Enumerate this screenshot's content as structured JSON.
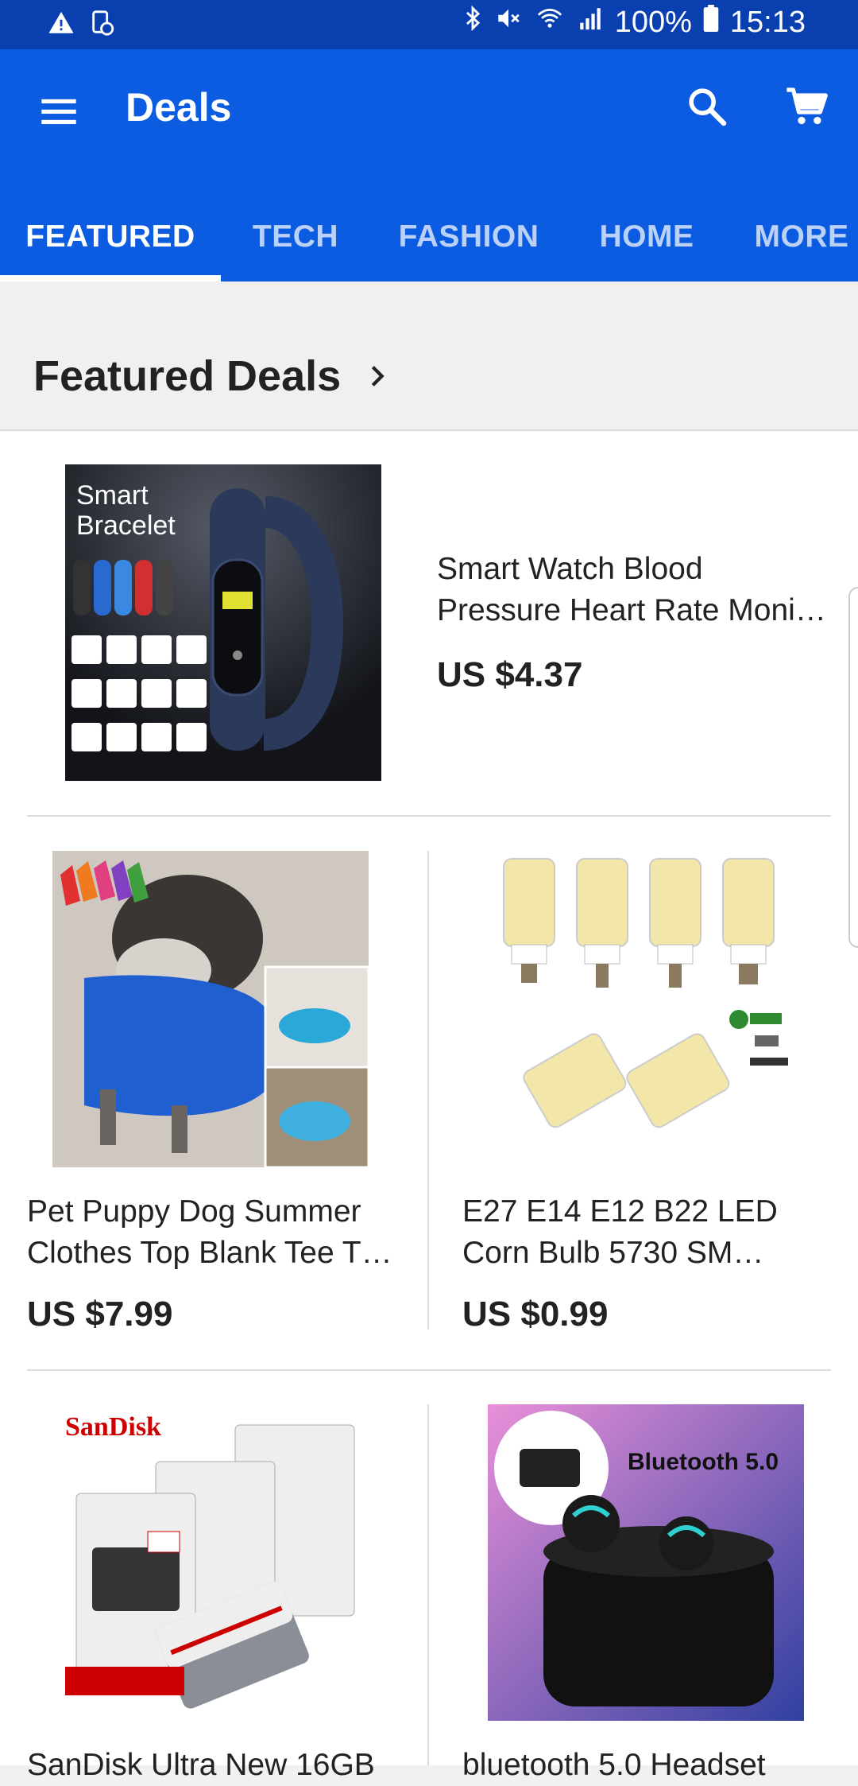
{
  "status": {
    "battery": "100%",
    "time": "15:13"
  },
  "appbar": {
    "title": "Deals"
  },
  "tabs": [
    {
      "label": "FEATURED"
    },
    {
      "label": "TECH"
    },
    {
      "label": "FASHION"
    },
    {
      "label": "HOME"
    },
    {
      "label": "MORE"
    }
  ],
  "section": {
    "title": "Featured Deals"
  },
  "products": [
    {
      "name": "Smart Watch Blood Pressure Heart Rate Moni…",
      "price": "US $4.37",
      "image_text": "Smart Bracelet"
    },
    {
      "name": "Pet Puppy Dog Summer Clothes Top Blank Tee T…",
      "price": "US $7.99"
    },
    {
      "name": "E27 E14 E12 B22 LED Corn Bulb 5730 SM…",
      "price": "US $0.99"
    },
    {
      "name": "SanDisk Ultra New 16GB",
      "price": "",
      "image_text": "SanDisk"
    },
    {
      "name": "bluetooth 5.0 Headset",
      "price": "",
      "image_text": "Bluetooth 5.0"
    }
  ],
  "colors": {
    "status_bar": "#0a3fb0",
    "app_bar": "#0b5ce0"
  }
}
